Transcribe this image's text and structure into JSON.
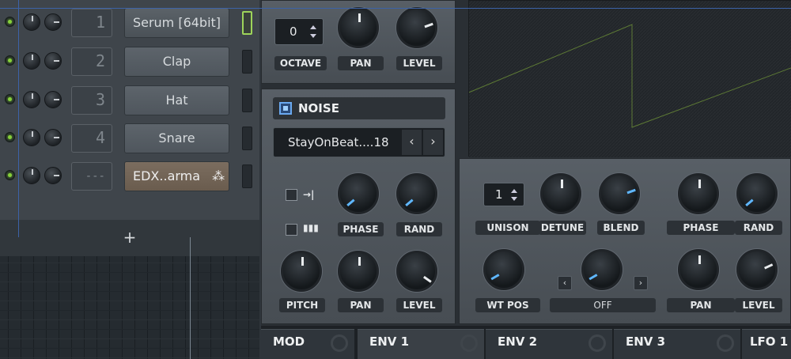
{
  "channel_rack": {
    "channels": [
      {
        "number": "1",
        "name": "Serum [64bit]",
        "selected": true
      },
      {
        "number": "2",
        "name": "Clap",
        "selected": false
      },
      {
        "number": "3",
        "name": "Hat",
        "selected": false
      },
      {
        "number": "4",
        "name": "Snare",
        "selected": false
      },
      {
        "number": "---",
        "name": "EDX..arma",
        "selected": false
      }
    ],
    "add_label": "+"
  },
  "osc_top": {
    "octave_value": "0",
    "labels": {
      "octave": "OCTAVE",
      "pan": "PAN",
      "level": "LEVEL"
    }
  },
  "noise": {
    "title": "NOISE",
    "preset": "StayOnBeat....18",
    "prev_icon": "chevron-left-icon",
    "next_icon": "chevron-right-icon",
    "labels": {
      "phase": "PHASE",
      "rand": "RAND",
      "pitch": "PITCH",
      "pan": "PAN",
      "level": "LEVEL"
    }
  },
  "osc_main": {
    "unison_value": "1",
    "labels": {
      "unison": "UNISON",
      "detune": "DETUNE",
      "blend": "BLEND",
      "phase": "PHASE",
      "rand": "RAND",
      "wt_pos": "WT POS",
      "off": "OFF",
      "pan": "PAN",
      "level": "LEVEL"
    }
  },
  "tabs": [
    {
      "label": "MOD",
      "active": false
    },
    {
      "label": "ENV 1",
      "active": true
    },
    {
      "label": "ENV 2",
      "active": false
    },
    {
      "label": "ENV 3",
      "active": false
    },
    {
      "label": "LFO 1",
      "active": false
    }
  ],
  "colors": {
    "led_green": "#86d13a",
    "blue_indicator": "#5fb7ff",
    "waveform": "#6c8f3e"
  }
}
